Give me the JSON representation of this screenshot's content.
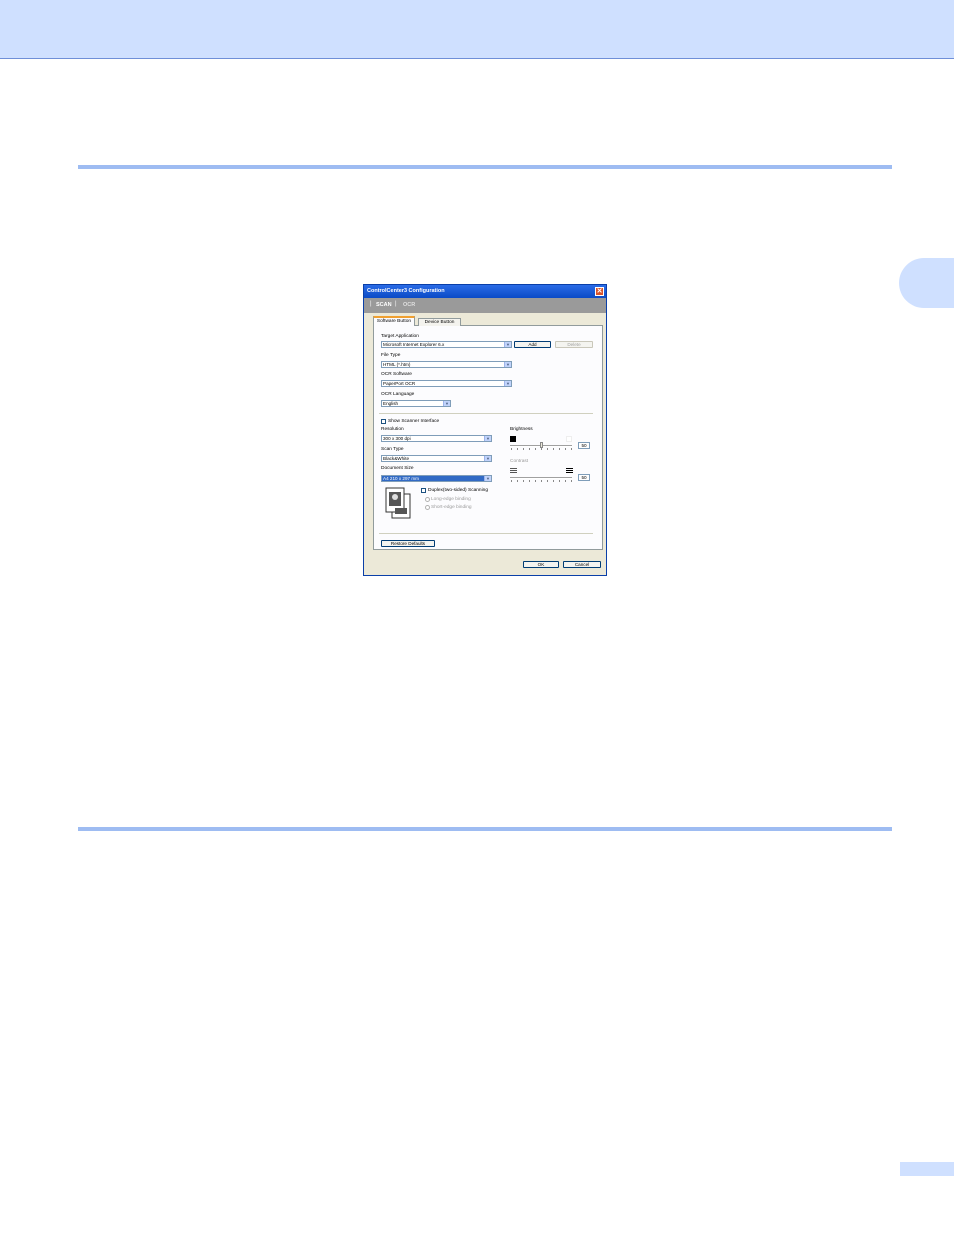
{
  "dialog": {
    "title": "ControlCenter3 Configuration",
    "close_glyph": "✕",
    "top_tabs": [
      "SCAN",
      "OCR"
    ],
    "sub_tabs": [
      "Software Button",
      "Device Button"
    ],
    "target_application": {
      "label": "Target Application",
      "value": "Microsoft Internet Explorer 6.x"
    },
    "add_button": "Add",
    "delete_button": "Delete",
    "file_type": {
      "label": "File Type",
      "value": "HTML (*.htm)"
    },
    "ocr_software": {
      "label": "OCR Software",
      "value": "PaperPort OCR"
    },
    "ocr_language": {
      "label": "OCR Language",
      "value": "English"
    },
    "show_scanner_interface": "Show Scanner Interface",
    "resolution": {
      "label": "Resolution",
      "value": "300 x 300 dpi"
    },
    "scan_type": {
      "label": "Scan Type",
      "value": "Black&White"
    },
    "document_size": {
      "label": "Document Size",
      "value": "A4 210 x 297 mm"
    },
    "duplex": "Duplex(two-sided) Scanning",
    "long_edge": "Long-edge binding",
    "short_edge": "Short-edge binding",
    "brightness": {
      "label": "Brightness",
      "value": "50"
    },
    "contrast": {
      "label": "Contrast",
      "value": "50"
    },
    "restore_defaults": "Restore Defaults",
    "ok_button": "OK",
    "cancel_button": "Cancel"
  }
}
